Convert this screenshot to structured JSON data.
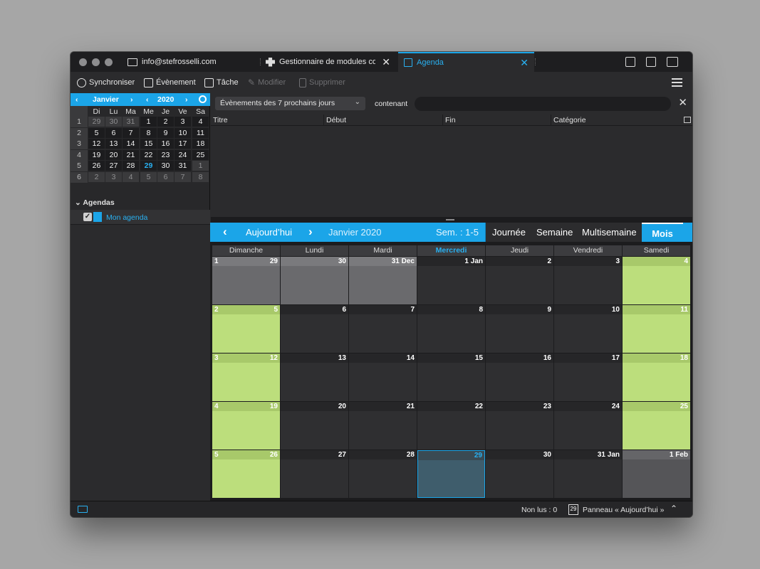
{
  "tabs": [
    {
      "label": "info@stefrosselli.com"
    },
    {
      "label": "Gestionnaire de modules co"
    },
    {
      "label": "Agenda"
    }
  ],
  "tab_close": "✕",
  "toolbar": {
    "sync": "Synchroniser",
    "event": "Évènement",
    "task": "Tâche",
    "edit": "Modifier",
    "delete": "Supprimer"
  },
  "minical": {
    "month": "Janvier",
    "year": "2020",
    "daynames": [
      "Di",
      "Lu",
      "Ma",
      "Me",
      "Je",
      "Ve",
      "Sa"
    ],
    "weeks": [
      {
        "wk": "1",
        "days": [
          "29",
          "30",
          "31",
          "1",
          "2",
          "3",
          "4"
        ]
      },
      {
        "wk": "2",
        "days": [
          "5",
          "6",
          "7",
          "8",
          "9",
          "10",
          "11"
        ]
      },
      {
        "wk": "3",
        "days": [
          "12",
          "13",
          "14",
          "15",
          "16",
          "17",
          "18"
        ]
      },
      {
        "wk": "4",
        "days": [
          "19",
          "20",
          "21",
          "22",
          "23",
          "24",
          "25"
        ]
      },
      {
        "wk": "5",
        "days": [
          "26",
          "27",
          "28",
          "29",
          "30",
          "31",
          "1"
        ]
      },
      {
        "wk": "6",
        "days": [
          "2",
          "3",
          "4",
          "5",
          "6",
          "7",
          "8"
        ]
      }
    ]
  },
  "agendas": {
    "header": "Agendas",
    "items": [
      {
        "name": "Mon agenda",
        "checked": "✓",
        "color": "#1ba5e8"
      }
    ]
  },
  "filter": {
    "select_value": "Évènements des 7 prochains jours",
    "contains_label": "contenant",
    "search_value": "",
    "close": "✕"
  },
  "list_columns": [
    "Titre",
    "Début",
    "Fin",
    "Catégorie"
  ],
  "nav": {
    "today": "Aujourd’hui",
    "month_label": "Janvier 2020",
    "week_label": "Sem. : 1-5",
    "views": [
      "Journée",
      "Semaine",
      "Multisemaine",
      "Mois"
    ],
    "active_view": "Mois"
  },
  "month_grid": {
    "daynames": [
      "Dimanche",
      "Lundi",
      "Mardi",
      "Mercredi",
      "Jeudi",
      "Vendredi",
      "Samedi"
    ],
    "today_col": 3,
    "rows": [
      {
        "wk": "1",
        "cells": [
          "29",
          "30",
          "31 Dec",
          "1 Jan",
          "2",
          "3",
          "4"
        ],
        "types": [
          "other",
          "other",
          "other",
          "",
          "",
          "",
          "weekend"
        ]
      },
      {
        "wk": "2",
        "cells": [
          "5",
          "6",
          "7",
          "8",
          "9",
          "10",
          "11"
        ],
        "types": [
          "weekend",
          "",
          "",
          "",
          "",
          "",
          "weekend"
        ]
      },
      {
        "wk": "3",
        "cells": [
          "12",
          "13",
          "14",
          "15",
          "16",
          "17",
          "18"
        ],
        "types": [
          "weekend",
          "",
          "",
          "",
          "",
          "",
          "weekend"
        ]
      },
      {
        "wk": "4",
        "cells": [
          "19",
          "20",
          "21",
          "22",
          "23",
          "24",
          "25"
        ],
        "types": [
          "weekend",
          "",
          "",
          "",
          "",
          "",
          "weekend"
        ]
      },
      {
        "wk": "5",
        "cells": [
          "26",
          "27",
          "28",
          "29",
          "30",
          "31 Jan",
          "1 Feb"
        ],
        "types": [
          "weekend",
          "",
          "",
          "today",
          "",
          "",
          "nextm"
        ]
      }
    ]
  },
  "status": {
    "unread": "Non lus : 0",
    "panel": "Panneau « Aujourd’hui »",
    "cal_day": "29"
  },
  "colors": {
    "accent": "#1ba5e8",
    "weekend": "#bcde7c",
    "background": "#2b2b2d"
  }
}
